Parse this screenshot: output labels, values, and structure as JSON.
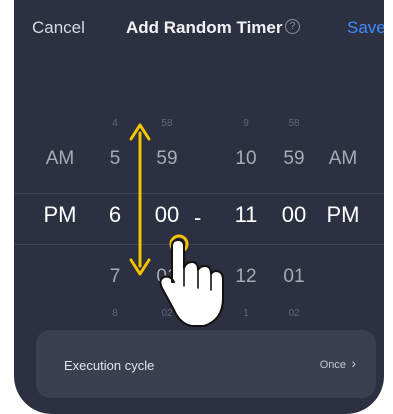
{
  "header": {
    "cancel_label": "Cancel",
    "title": "Add Random Timer",
    "help_icon": "help-circle-icon",
    "save_label": "Save"
  },
  "picker": {
    "start_ampm": {
      "upper": "AM",
      "selected": "PM"
    },
    "start_hour": {
      "faint_top": "4",
      "upper": "5",
      "selected": "6",
      "lower": "7",
      "faint_bottom": "8"
    },
    "start_minute": {
      "faint_top": "58",
      "upper": "59",
      "selected": "00",
      "lower": "01",
      "faint_bottom": "02"
    },
    "separator": "-",
    "end_hour": {
      "faint_top": "9",
      "upper": "10",
      "selected": "11",
      "lower": "12",
      "faint_bottom": "1"
    },
    "end_minute": {
      "faint_top": "58",
      "upper": "59",
      "selected": "00",
      "lower": "01",
      "faint_bottom": "02"
    },
    "end_ampm": {
      "upper": "AM",
      "selected": "PM"
    }
  },
  "execution_cycle": {
    "label": "Execution cycle",
    "value": "Once"
  },
  "colors": {
    "background": "#2c3040",
    "accent": "#3f8cff",
    "gesture_arrow": "#f5c400"
  }
}
